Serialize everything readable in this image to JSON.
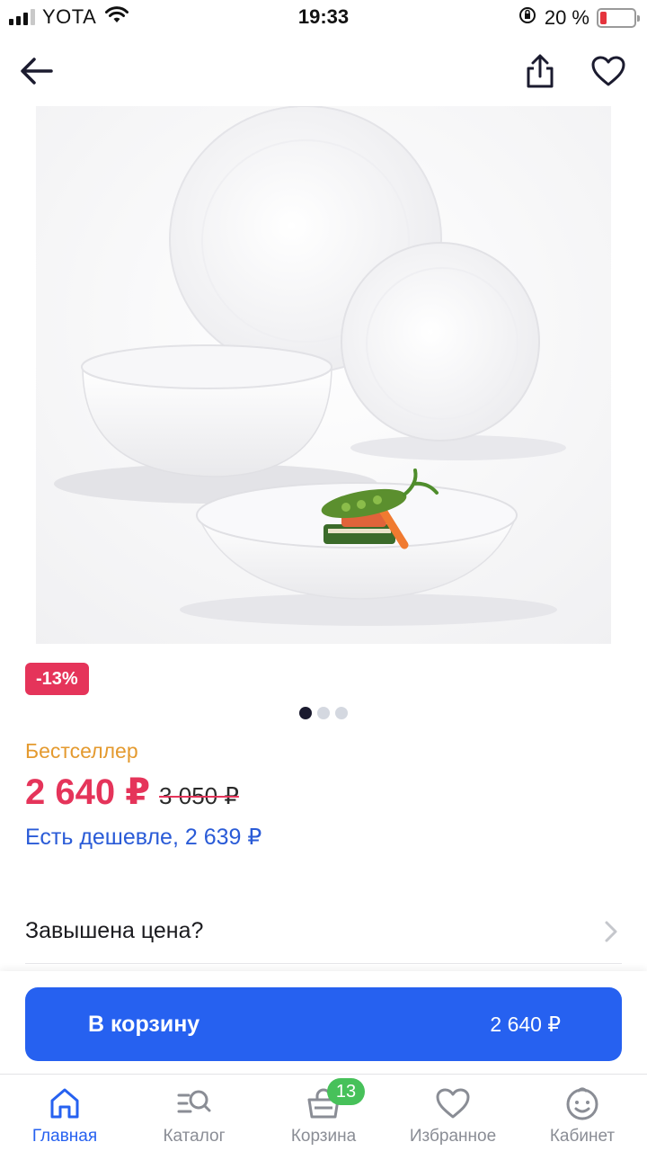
{
  "status_bar": {
    "carrier": "YOTA",
    "time": "19:33",
    "battery_percent": "20 %",
    "battery_level": 0.2
  },
  "nav": {
    "back_icon": "arrow-left-icon",
    "share_icon": "share-icon",
    "favorite_icon": "heart-icon"
  },
  "product": {
    "discount_badge": "-13%",
    "image_count": 3,
    "active_image_index": 0,
    "bestseller_label": "Бестселлер",
    "price_current": "2 640 ₽",
    "price_old": "3 050 ₽",
    "cheaper_link": "Есть дешевле, 2 639 ₽",
    "overpriced_label": "Завышена цена?"
  },
  "cart_button": {
    "label": "В корзину",
    "price": "2 640 ₽"
  },
  "tab_bar": {
    "items": [
      {
        "label": "Главная",
        "icon": "home-icon",
        "active": true
      },
      {
        "label": "Каталог",
        "icon": "catalog-search-icon",
        "active": false
      },
      {
        "label": "Корзина",
        "icon": "basket-icon",
        "active": false,
        "badge": "13"
      },
      {
        "label": "Избранное",
        "icon": "heart-icon",
        "active": false
      },
      {
        "label": "Кабинет",
        "icon": "smiley-icon",
        "active": false
      }
    ]
  },
  "colors": {
    "accent_blue": "#2661f0",
    "price_red": "#e5345a",
    "bestseller_orange": "#e49a2f",
    "badge_green": "#47c15a"
  }
}
